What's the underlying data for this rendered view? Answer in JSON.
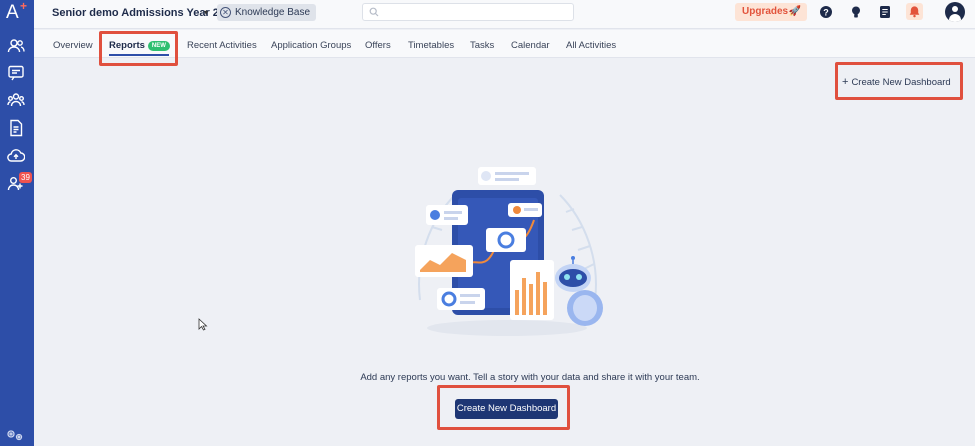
{
  "app": {
    "logo_text": "A",
    "title": "Senior demo Admissions Year 202...",
    "knowledge_base": "Knowledge Base",
    "upgrades_label": "Upgrades",
    "sidebar_badge": "39"
  },
  "tabs": [
    {
      "label": "Overview"
    },
    {
      "label": "Reports",
      "badge": "NEW",
      "active": true
    },
    {
      "label": "Recent Activities"
    },
    {
      "label": "Application Groups"
    },
    {
      "label": "Offers"
    },
    {
      "label": "Timetables"
    },
    {
      "label": "Tasks"
    },
    {
      "label": "Calendar"
    },
    {
      "label": "All Activities"
    }
  ],
  "main": {
    "create_top_label": "Create New Dashboard",
    "empty_message": "Add any reports you want. Tell a story with your data and share it with your team.",
    "create_button_label": "Create New Dashboard"
  },
  "icons": {
    "sidebar": [
      "contacts-icon",
      "chat-icon",
      "people-icon",
      "document-icon",
      "cloud-upload-icon",
      "user-group-icon"
    ],
    "top": [
      "help-icon",
      "lightbulb-icon",
      "notes-icon",
      "bell-icon",
      "account-icon"
    ]
  },
  "colors": {
    "sidebar": "#2d4ea8",
    "primary_button": "#1e3674",
    "upgrades_bg": "#fde4d6",
    "upgrades_text": "#e2533b",
    "highlight": "#e0503e",
    "new_badge": "#2fbf71"
  }
}
